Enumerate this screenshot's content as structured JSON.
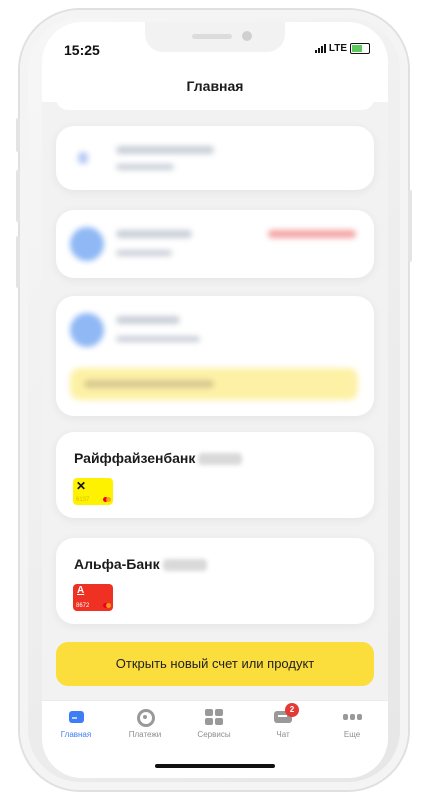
{
  "status_bar": {
    "time": "15:25",
    "network": "LTE"
  },
  "header": {
    "title": "Главная"
  },
  "banks": [
    {
      "name": "Райффайзенбанк",
      "card_number": "6137",
      "card_color": "#fff200"
    },
    {
      "name": "Альфа-Банк",
      "card_number": "8672",
      "card_color": "#ef3124"
    }
  ],
  "cta": {
    "label": "Открыть новый счет или продукт"
  },
  "tabs": [
    {
      "label": "Главная",
      "active": true
    },
    {
      "label": "Платежи",
      "active": false
    },
    {
      "label": "Сервисы",
      "active": false
    },
    {
      "label": "Чат",
      "active": false,
      "badge": "2"
    },
    {
      "label": "Еще",
      "active": false
    }
  ],
  "colors": {
    "accent": "#3e7df5",
    "cta": "#fbdd3c",
    "badge": "#e53935"
  }
}
